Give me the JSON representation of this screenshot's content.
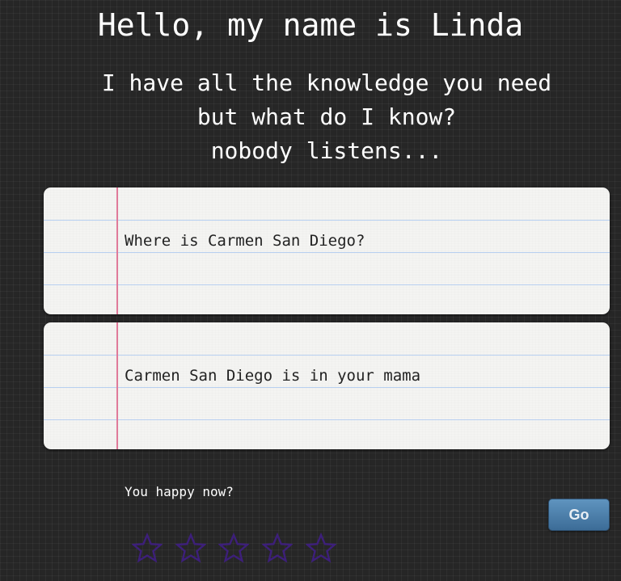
{
  "header": {
    "title": "Hello, my name is Linda",
    "subtitle_lines": [
      "I have all the knowledge you need",
      "but what do I know?",
      "nobody listens..."
    ]
  },
  "question_card": {
    "text": "Where is Carmen San Diego?"
  },
  "answer_card": {
    "text": "Carmen San Diego is in your mama"
  },
  "feedback": {
    "prompt": "You happy now?",
    "rating": {
      "max": 5,
      "value": 0,
      "icon": "star-outline-icon",
      "color": "#3d1f7a"
    }
  },
  "go_button": {
    "label": "Go"
  },
  "colors": {
    "background": "#262626",
    "paper": "#f4f4f2",
    "rule_line": "#b7cff0",
    "margin_line": "#e07a9a",
    "button": "#4d80ad"
  }
}
